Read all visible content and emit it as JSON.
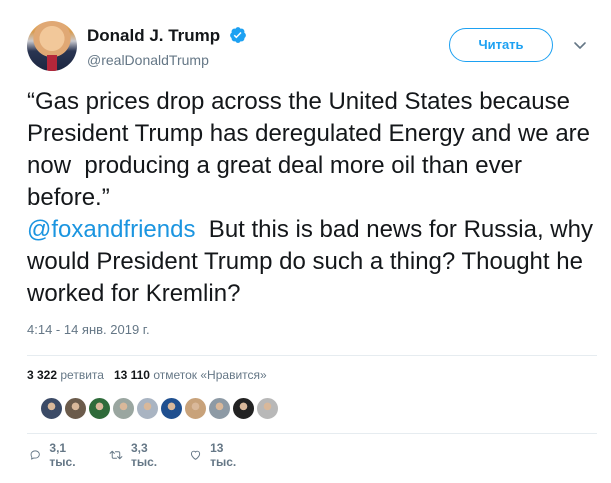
{
  "user": {
    "display_name": "Donald J. Trump",
    "handle": "@realDonaldTrump",
    "verified_icon": "verified-badge-icon"
  },
  "follow_button": {
    "label": "Читать"
  },
  "tweet": {
    "text_part1": "“Gas prices drop across the United States because President Trump has deregulated Energy and we are now  producing a great deal more oil than ever before.”\n",
    "mention": "@foxandfriends",
    "text_part2": "  But this is bad news for Russia, why would President Trump do such a thing? Thought he worked for Kremlin?",
    "timestamp": "4:14 - 14 янв. 2019 г."
  },
  "stats": {
    "retweets_count": "3 322",
    "retweets_label": "ретвита",
    "likes_count": "13 110",
    "likes_label": "отметок «Нравится»"
  },
  "likers": {
    "count_shown": 10,
    "colors": [
      "#3b4a66",
      "#6b5b4b",
      "#2f6b3a",
      "#9aa6a0",
      "#a9b4c2",
      "#1f4f8f",
      "#c8a27a",
      "#8d9aa5",
      "#222222",
      "#b8b8b8",
      "#9a6a4a"
    ]
  },
  "actions": {
    "replies": "3,1 тыс.",
    "retweets": "3,3 тыс.",
    "likes": "13 тыс."
  },
  "colors": {
    "accent": "#1da1f2",
    "link": "#1b95e0",
    "secondary_text": "#657786",
    "divider": "#e6ecf0"
  }
}
